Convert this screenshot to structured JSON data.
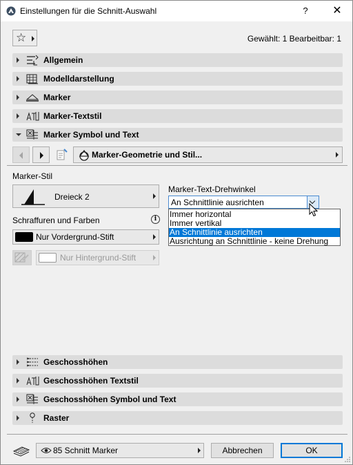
{
  "window": {
    "title": "Einstellungen für die Schnitt-Auswahl",
    "help": "?",
    "close": "✕"
  },
  "toolbar": {
    "favorites_icon": "star-icon",
    "selection_info": "Gewählt: 1 Bearbeitbar: 1"
  },
  "panels_top": [
    {
      "label": "Allgemein",
      "icon": "general-settings-icon",
      "expanded": false
    },
    {
      "label": "Modelldarstellung",
      "icon": "model-display-icon",
      "expanded": false
    },
    {
      "label": "Marker",
      "icon": "marker-icon",
      "expanded": false
    },
    {
      "label": "Marker-Textstil",
      "icon": "text-style-icon",
      "expanded": false
    },
    {
      "label": "Marker Symbol und Text",
      "icon": "symbol-text-icon",
      "expanded": true
    }
  ],
  "subpanel": {
    "label": "Marker-Geometrie und Stil..."
  },
  "marker_style": {
    "label": "Marker-Stil",
    "value": "Dreieck 2"
  },
  "hatching": {
    "label": "Schraffuren und Farben",
    "foreground": "Nur Vordergrund-Stift",
    "background": "Nur Hintergrund-Stift"
  },
  "rotation": {
    "label": "Marker-Text-Drehwinkel",
    "value": "An Schnittlinie ausrichten",
    "options": [
      "Immer horizontal",
      "Immer vertikal",
      "An Schnittlinie ausrichten",
      "Ausrichtung an Schnittlinie - keine Drehung"
    ],
    "selected_index": 2
  },
  "panels_bottom": [
    {
      "label": "Geschosshöhen",
      "icon": "story-levels-icon",
      "expanded": false
    },
    {
      "label": "Geschosshöhen Textstil",
      "icon": "text-style-icon",
      "expanded": false
    },
    {
      "label": "Geschosshöhen Symbol und Text",
      "icon": "symbol-text-icon",
      "expanded": false
    },
    {
      "label": "Raster",
      "icon": "grid-icon",
      "expanded": false
    }
  ],
  "footer": {
    "layer": "85 Schnitt Marker",
    "cancel": "Abbrechen",
    "ok": "OK"
  },
  "colors": {
    "accent": "#0078d7",
    "panel": "#dcdcdc",
    "background": "#f0f0f0"
  }
}
